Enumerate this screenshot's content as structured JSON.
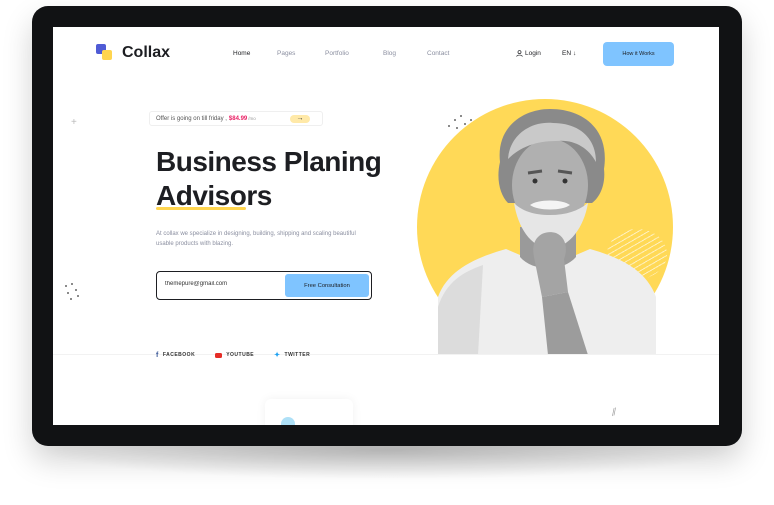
{
  "brand": {
    "name": "Collax"
  },
  "nav": {
    "items": [
      {
        "label": "Home",
        "active": true
      },
      {
        "label": "Pages",
        "active": false
      },
      {
        "label": "Portfolio",
        "active": false
      },
      {
        "label": "Blog",
        "active": false
      },
      {
        "label": "Contact",
        "active": false
      }
    ],
    "login": "Login",
    "language": "EN",
    "cta": "How it Works"
  },
  "offer": {
    "text": "Offer is going on till friday ,",
    "price": "$84.99",
    "per": "/mo"
  },
  "hero": {
    "title_line1": "Business Planing",
    "title_line2": "Advisors",
    "description": "At collax we specialize in designing, building, shipping and scaling beautiful usable products with blazing.",
    "email_value": "themepure@gmail.com",
    "button": "Free Consultation"
  },
  "socials": [
    {
      "label": "FACEBOOK",
      "icon": "facebook-icon"
    },
    {
      "label": "YOUTUBE",
      "icon": "youtube-icon"
    },
    {
      "label": "TWITTER",
      "icon": "twitter-icon"
    }
  ],
  "colors": {
    "accent_blue": "#7fc4ff",
    "accent_yellow": "#ffd957",
    "price_pink": "#e91e63"
  }
}
